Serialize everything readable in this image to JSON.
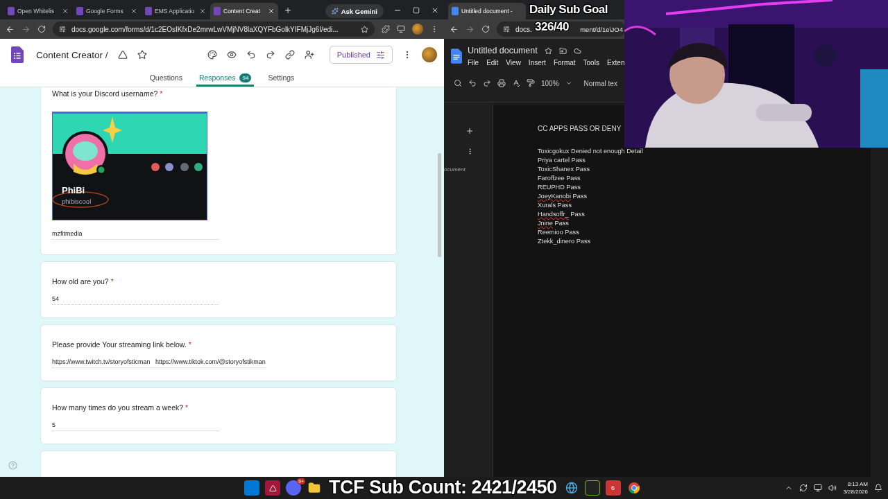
{
  "left_browser": {
    "tabs": [
      {
        "title": "Open Whitelis",
        "selected": false
      },
      {
        "title": "Google Forms",
        "selected": false
      },
      {
        "title": "EMS Applicatio",
        "selected": false
      },
      {
        "title": "Content Creat",
        "selected": true
      }
    ],
    "ask_gemini": "Ask Gemini",
    "url": "docs.google.com/forms/d/1c2EOsIKfxDe2mrwLwVMjNV8laXQYFbGolkYIFMjJg6I/edi...",
    "form_title": "Content Creator /",
    "publish_button": "Published",
    "form_tabs": [
      {
        "label": "Questions",
        "selected": false
      },
      {
        "label": "Responses",
        "selected": true,
        "badge": "94"
      },
      {
        "label": "Settings",
        "selected": false
      }
    ],
    "questions": [
      {
        "question": "What is your Discord username?",
        "required_mark": "*",
        "image": {
          "display_name": "PhiBi",
          "username": "phibiscool"
        },
        "answer": "mzfitmedia"
      },
      {
        "kind": "text",
        "question": "How old are you?",
        "required_mark": "*",
        "answer": "54"
      },
      {
        "kind": "text",
        "question": "Please provide Your streaming link below.",
        "required_mark": "*",
        "answer": "https://www.twitch.tv/storyofsticman   https://www.tiktok.com/@storyofstikman"
      },
      {
        "kind": "text",
        "question": "How many times do you stream a week?",
        "required_mark": "*",
        "answer": "5"
      },
      {
        "kind": "cut_off"
      }
    ]
  },
  "right_browser": {
    "tabs": [
      {
        "title": "Untitled document -",
        "selected": true
      }
    ],
    "url_start": "docs.",
    "url_end": "ment/d/1eiJO4",
    "doc_title": "Untitled document",
    "menu": [
      "File",
      "Edit",
      "View",
      "Insert",
      "Format",
      "Tools",
      "Exten"
    ],
    "zoom": "100%",
    "style": "Normal tex",
    "outline_label": "ocument",
    "document": {
      "heading": "CC APPS PASS OR DENY",
      "lines": [
        {
          "name": "Toxicgokux",
          "verdict": "Denied not enough Detail",
          "misspelled": false
        },
        {
          "name": "Priya cartel",
          "verdict": "Pass",
          "misspelled": false
        },
        {
          "name": "ToxicShanex",
          "verdict": "Pass",
          "misspelled": false
        },
        {
          "name": "Faroffzee",
          "verdict": "Pass",
          "misspelled": false
        },
        {
          "name": "REUPHD",
          "verdict": "Pass",
          "misspelled": false
        },
        {
          "name": "JoeyKanobi",
          "verdict": "Pass",
          "misspelled": true
        },
        {
          "name": "Xurals",
          "verdict": "Pass",
          "misspelled": false
        },
        {
          "name": "Handsoffr_",
          "verdict": "Pass",
          "misspelled": true
        },
        {
          "name": "Jnine",
          "verdict": "Pass",
          "misspelled": true
        },
        {
          "name": "Reemioo",
          "verdict": "Pass",
          "misspelled": false
        },
        {
          "name": "Ztekk_dinero",
          "verdict": "Pass",
          "misspelled": false
        }
      ]
    }
  },
  "stream_overlay": {
    "sub_goal_title": "Daily Sub Goal",
    "sub_goal_count": "326/40",
    "sub_count": "TCF Sub Count: 2421/2450"
  },
  "taskbar": {
    "discord_badge": "9+",
    "app_badge": "6",
    "time": "8:13 AM",
    "date": "3/28/2026"
  }
}
